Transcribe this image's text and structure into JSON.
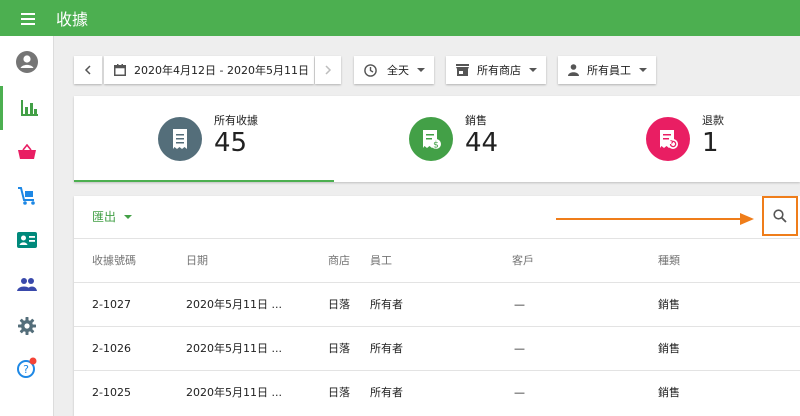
{
  "app": {
    "title": "收據"
  },
  "toolbar": {
    "date_range": "2020年4月12日 - 2020年5月11日",
    "time_filter": "全天",
    "store_filter": "所有商店",
    "employee_filter": "所有員工"
  },
  "summary": {
    "tabs": [
      {
        "label": "所有收據",
        "value": "45",
        "color": "#546e7a"
      },
      {
        "label": "銷售",
        "value": "44",
        "color": "#43a047"
      },
      {
        "label": "退款",
        "value": "1",
        "color": "#e91e63"
      }
    ]
  },
  "table": {
    "export_label": "匯出",
    "columns": [
      "收據號碼",
      "日期",
      "商店",
      "員工",
      "客戶",
      "種類"
    ],
    "rows": [
      [
        "2-1027",
        "2020年5月11日 ...",
        "日落",
        "所有者",
        "—",
        "銷售"
      ],
      [
        "2-1026",
        "2020年5月11日 ...",
        "日落",
        "所有者",
        "—",
        "銷售"
      ],
      [
        "2-1025",
        "2020年5月11日 ...",
        "日落",
        "所有者",
        "—",
        "銷售"
      ]
    ]
  },
  "colors": {
    "brand": "#4caf50",
    "highlight": "#ef7d1a"
  },
  "icons": [
    "menu-icon",
    "account-icon",
    "bar-chart-icon",
    "basket-icon",
    "cart-icon",
    "badge-icon",
    "people-icon",
    "gear-icon",
    "help-icon",
    "calendar-icon",
    "clock-icon",
    "store-icon",
    "person-icon",
    "receipt-icon",
    "search-icon"
  ]
}
